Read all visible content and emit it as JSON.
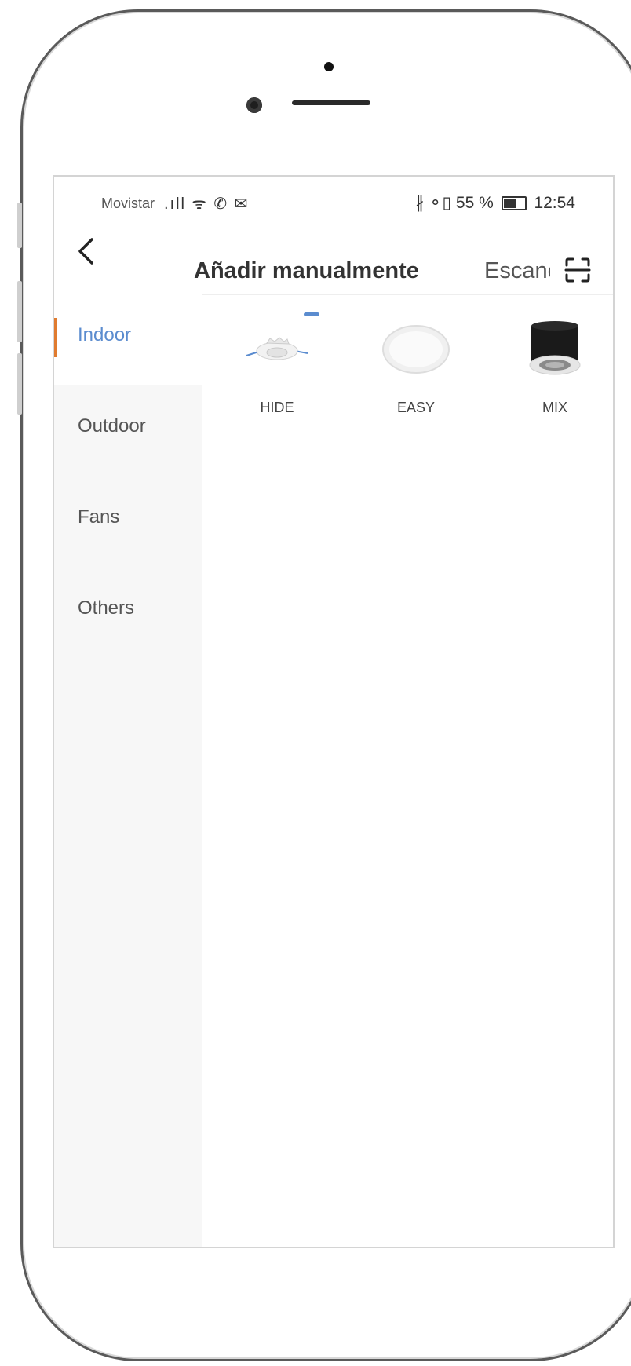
{
  "status_bar": {
    "carrier": "Movistar",
    "signals": ".ıll ᯤ ✆ ✉",
    "right_icons": "∦ ⚬▯ 55 %",
    "time": "12:54"
  },
  "header": {
    "back_symbol": "<",
    "title": "Añadir manualmente",
    "scan_label": "Escanear"
  },
  "sidebar": {
    "items": [
      {
        "label": "Indoor"
      },
      {
        "label": "Outdoor"
      },
      {
        "label": "Fans"
      },
      {
        "label": "Others"
      }
    ]
  },
  "products": [
    {
      "label": "HIDE",
      "icon": "recessed-downlight-icon"
    },
    {
      "label": "EASY",
      "icon": "round-panel-icon"
    },
    {
      "label": "MIX",
      "icon": "cylinder-light-icon"
    }
  ],
  "colors": {
    "accent": "#5b8ccf",
    "active_marker": "#e07b2f"
  }
}
